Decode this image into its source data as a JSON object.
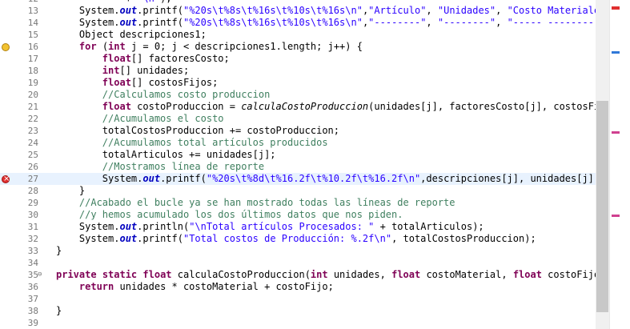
{
  "editor": {
    "lines": [
      {
        "num": "12",
        "code": "            + \"\\n\");"
      },
      {
        "num": "13",
        "code": "    System.out.printf(\"%20s\\t%8s\\t%16s\\t%10s\\t%16s\\n\",\"Artículo\", \"Unidades\", \"Costo Materiales\""
      },
      {
        "num": "14",
        "code": "    System.out.printf(\"%20s\\t%8s\\t%16s\\t%10s\\t%16s\\n\",\"--------\", \"--------\", \"----- ----------\""
      },
      {
        "num": "15",
        "code": "    Object descripciones1;"
      },
      {
        "num": "16",
        "code": "    for (int j = 0; j < descripciones1.length; j++) {"
      },
      {
        "num": "17",
        "code": "        float[] factoresCosto;"
      },
      {
        "num": "18",
        "code": "        int[] unidades;"
      },
      {
        "num": "19",
        "code": "        float[] costosFijos;"
      },
      {
        "num": "20",
        "code": "        //Calculamos costo produccion"
      },
      {
        "num": "21",
        "code": "        float costoProduccion = calculaCostoProduccion(unidades[j], factoresCosto[j], costosFijos"
      },
      {
        "num": "22",
        "code": "        //Acumulamos el costo"
      },
      {
        "num": "23",
        "code": "        totalCostosProduccion += costoProduccion;"
      },
      {
        "num": "24",
        "code": "        //Acumulamos total artículos producidos"
      },
      {
        "num": "25",
        "code": "        totalArticulos += unidades[j];"
      },
      {
        "num": "26",
        "code": "        //Mostramos línea de reporte"
      },
      {
        "num": "27",
        "code": "        System.out.printf(\"%20s\\t%8d\\t%16.2f\\t%10.2f\\t%16.2f\\n\",descripciones[j], unidades[j], fa"
      },
      {
        "num": "28",
        "code": "    }"
      },
      {
        "num": "29",
        "code": "    //Acabado el bucle ya se han mostrado todas las líneas de reporte"
      },
      {
        "num": "30",
        "code": "    //y hemos acumulado los dos últimos datos que nos piden."
      },
      {
        "num": "31",
        "code": "    System.out.println(\"\\nTotal artículos Procesados: \" + totalArticulos);"
      },
      {
        "num": "32",
        "code": "    System.out.printf(\"Total costos de Producción: %.2f\\n\", totalCostosProduccion);"
      },
      {
        "num": "33",
        "code": "}"
      },
      {
        "num": "34",
        "code": ""
      },
      {
        "num": "35",
        "code": "private static float calculaCostoProduccion(int unidades, float costoMaterial, float costoFijo) {"
      },
      {
        "num": "36",
        "code": "    return unidades * costoMaterial + costoFijo;"
      },
      {
        "num": "37",
        "code": ""
      },
      {
        "num": "38",
        "code": "}"
      },
      {
        "num": "39",
        "code": ""
      }
    ],
    "markers": {
      "16": "warn",
      "27": "err"
    },
    "fold_marker": "⊖",
    "highlight_line": "27"
  }
}
